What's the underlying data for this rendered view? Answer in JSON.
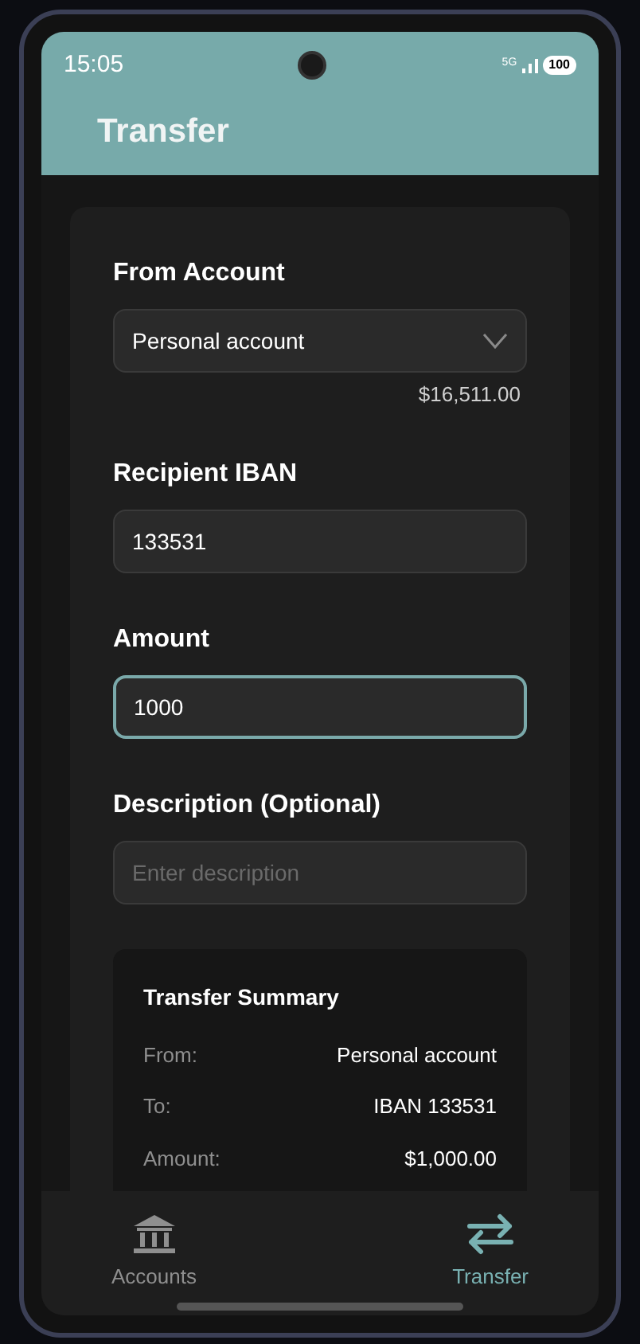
{
  "status_bar": {
    "time": "15:05",
    "network": "5G",
    "battery": "100"
  },
  "header": {
    "title": "Transfer"
  },
  "form": {
    "fields": [
      {
        "kind": "select",
        "label": "From Account",
        "value": "Personal account",
        "note": "$16,511.00",
        "focused": false
      },
      {
        "kind": "input",
        "label": "Recipient IBAN",
        "value": "133531",
        "focused": false
      },
      {
        "kind": "input",
        "label": "Amount",
        "value": "1000",
        "focused": true
      },
      {
        "kind": "input",
        "label": "Description (Optional)",
        "placeholder": "Enter description",
        "focused": false
      }
    ]
  },
  "summary": {
    "title": "Transfer Summary",
    "rows": [
      {
        "label": "From:",
        "value": "Personal account"
      },
      {
        "label": "To:",
        "value": "IBAN 133531"
      },
      {
        "label": "Amount:",
        "value": "$1,000.00"
      }
    ]
  },
  "bottom_nav": [
    {
      "kind": "bank",
      "label": "Accounts",
      "selected": false
    },
    {
      "kind": "swap",
      "label": "Transfer",
      "selected": true
    }
  ]
}
